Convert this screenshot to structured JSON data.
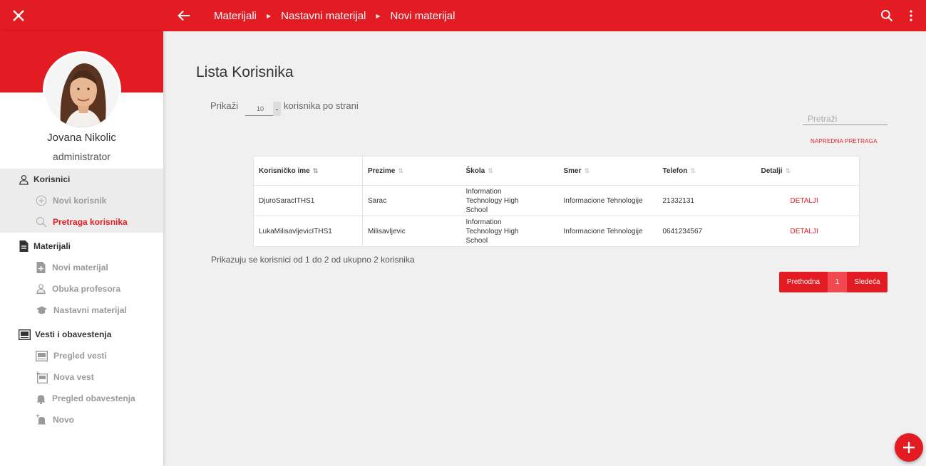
{
  "topbar": {
    "breadcrumbs": [
      "Materijali",
      "Nastavni materijal",
      "Novi materijal"
    ]
  },
  "sidebar": {
    "user_name": "Jovana Nikolic",
    "user_role": "administrator",
    "sections": [
      {
        "label": "Korisnici",
        "items": [
          "Novi korisnik",
          "Pretraga korisnika"
        ]
      },
      {
        "label": "Materijali",
        "items": [
          "Novi materijal",
          "Obuka profesora",
          "Nastavni materijal"
        ]
      },
      {
        "label": "Vesti i obavestenja",
        "items": [
          "Pregled vesti",
          "Nova vest",
          "Pregled obavestenja",
          "Novo"
        ]
      }
    ]
  },
  "main": {
    "title": "Lista Korisnika",
    "show_label": "Prikaži",
    "page_size": "10",
    "per_page_label": "korisnika po strani",
    "search_placeholder": "Pretraži",
    "advanced_search": "NAPREDNA PRETRAGA",
    "table": {
      "headers": [
        "Korisničko ime",
        "Prezime",
        "Škola",
        "Smer",
        "Telefon",
        "Detalji"
      ],
      "rows": [
        {
          "username": "DjuroSaracITHS1",
          "lastname": "Sarac",
          "school": "Information Technology High School",
          "major": "Informacione Tehnologije",
          "phone": "21332131",
          "details": "DETALJI"
        },
        {
          "username": "LukaMilisavljevicITHS1",
          "lastname": "Milisavljevic",
          "school": "Information Technology High School",
          "major": "Informacione Tehnologije",
          "phone": "0641234567",
          "details": "DETALJI"
        }
      ]
    },
    "info": "Prikazuju se korisnici od 1 do 2 od ukupno 2 korisnika",
    "pager": {
      "prev": "Prethodna",
      "current": "1",
      "next": "Sledeća"
    }
  },
  "colors": {
    "accent": "#e31b23"
  }
}
